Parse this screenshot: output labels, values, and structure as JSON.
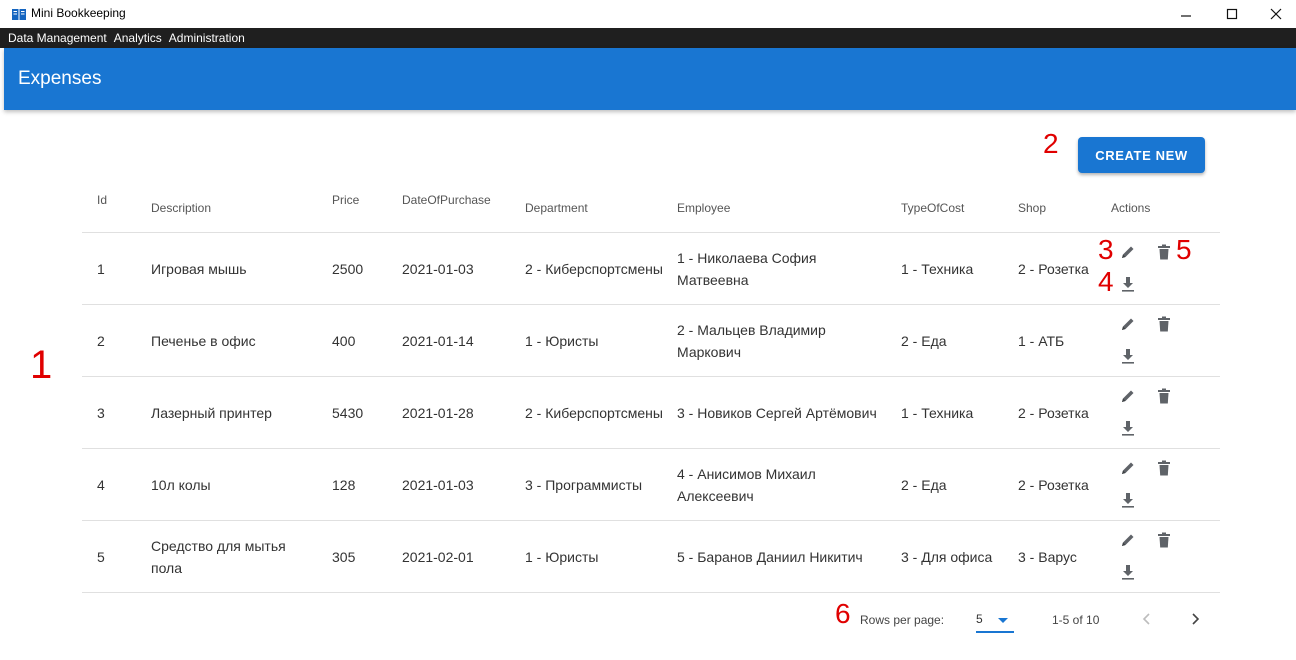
{
  "window": {
    "title": "Mini Bookkeeping",
    "minimize": "—",
    "maximize": "☐",
    "close": "✕"
  },
  "menu": [
    "Data Management",
    "Analytics",
    "Administration"
  ],
  "page": {
    "title": "Expenses"
  },
  "toolbar": {
    "create_label": "CREATE NEW"
  },
  "table": {
    "headers": {
      "id": "Id",
      "description": "Description",
      "price": "Price",
      "date": "DateOfPurchase",
      "department": "Department",
      "employee": "Employee",
      "type": "TypeOfCost",
      "shop": "Shop",
      "actions": "Actions"
    },
    "rows": [
      {
        "id": "1",
        "description": "Игровая мышь",
        "price": "2500",
        "date": "2021-01-03",
        "department": "2 - Киберспортсмены",
        "employee": "1 - Николаева София Матвеевна",
        "type": "1 - Техника",
        "shop": "2 - Розетка"
      },
      {
        "id": "2",
        "description": "Печенье в офис",
        "price": "400",
        "date": "2021-01-14",
        "department": "1 - Юристы",
        "employee": "2 - Мальцев Владимир Маркович",
        "type": "2 - Еда",
        "shop": "1 - АТБ"
      },
      {
        "id": "3",
        "description": "Лазерный принтер",
        "price": "5430",
        "date": "2021-01-28",
        "department": "2 - Киберспортсмены",
        "employee": "3 - Новиков Сергей Артёмович",
        "type": "1 - Техника",
        "shop": "2 - Розетка"
      },
      {
        "id": "4",
        "description": "10л колы",
        "price": "128",
        "date": "2021-01-03",
        "department": "3 - Программисты",
        "employee": "4 - Анисимов Михаил Алексеевич",
        "type": "2 - Еда",
        "shop": "2 - Розетка"
      },
      {
        "id": "5",
        "description": "Средство для мытья пола",
        "price": "305",
        "date": "2021-02-01",
        "department": "1 - Юристы",
        "employee": "5 - Баранов Даниил Никитич",
        "type": "3 - Для офиса",
        "shop": "3 - Варус"
      }
    ]
  },
  "pagination": {
    "rows_per_page_label": "Rows per page:",
    "rows_per_page_value": "5",
    "range": "1-5 of 10"
  },
  "annotations": [
    "1",
    "2",
    "3",
    "4",
    "5",
    "6"
  ],
  "icons": {
    "app": "book-icon",
    "edit": "pencil-icon",
    "delete": "trash-icon",
    "download": "download-icon",
    "prev": "chevron-left-icon",
    "next": "chevron-right-icon"
  },
  "colors": {
    "primary": "#1976d2",
    "menubar": "#1f1f1f",
    "annotation": "#e00000"
  }
}
